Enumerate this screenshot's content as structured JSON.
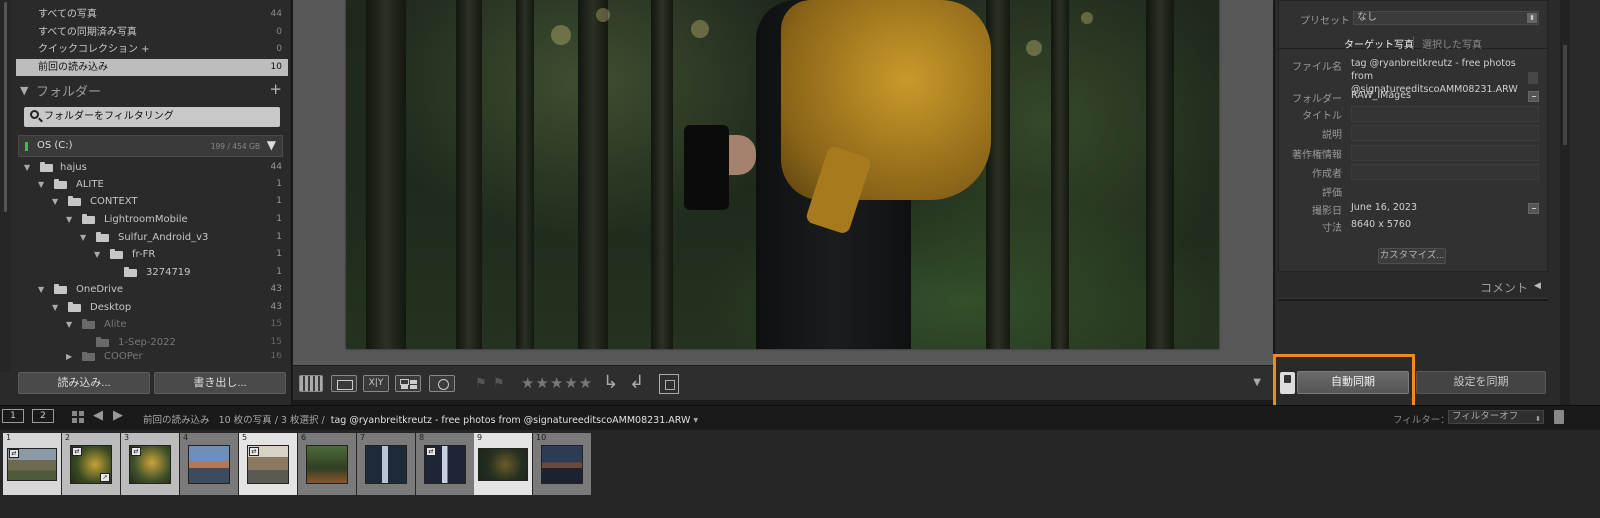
{
  "left_panel": {
    "catalog": [
      {
        "label": "すべての写真",
        "count": "44"
      },
      {
        "label": "すべての同期済み写真",
        "count": "0"
      },
      {
        "label": "クイックコレクション  +",
        "count": "0"
      },
      {
        "label": "前回の読み込み",
        "count": "10"
      }
    ],
    "folders_title": "フォルダー",
    "folders_add": "+",
    "folder_filter_placeholder": "フォルダーをフィルタリング",
    "volume": {
      "name": "OS (C:)",
      "usage": "199 / 454 GB"
    },
    "tree": [
      {
        "name": "hajus",
        "count": "44"
      },
      {
        "name": "ALITE",
        "count": "1"
      },
      {
        "name": "CONTEXT",
        "count": "1"
      },
      {
        "name": "LightroomMobile",
        "count": "1"
      },
      {
        "name": "Sulfur_Android_v3",
        "count": "1"
      },
      {
        "name": "fr-FR",
        "count": "1"
      },
      {
        "name": "3274719",
        "count": "1"
      },
      {
        "name": "OneDrive",
        "count": "43"
      },
      {
        "name": "Desktop",
        "count": "43"
      },
      {
        "name": "Alite",
        "count": "15"
      },
      {
        "name": "1-Sep-2022",
        "count": "15"
      },
      {
        "name": "COOPer",
        "count": "16"
      }
    ],
    "import_button": "読み込み...",
    "export_button": "書き出し..."
  },
  "toolbar": {
    "xy_label": "X|Y",
    "stars": "★★★★★"
  },
  "right_panel": {
    "preset_label": "プリセット",
    "preset_value": "なし",
    "tab_target": "ターゲット写真",
    "tab_selected": "選択した写真",
    "metadata": {
      "filename_label": "ファイル名",
      "filename_value": "tag @ryanbreitkreutz - free photos from @signatureeditscoAMM08231.ARW",
      "folder_label": "フォルダー",
      "folder_value": "RAW_IMages",
      "title_label": "タイトル",
      "caption_label": "説明",
      "copyright_label": "著作権情報",
      "creator_label": "作成者",
      "rating_label": "評価",
      "capture_label": "撮影日",
      "capture_value": "June 16, 2023",
      "dimensions_label": "寸法",
      "dimensions_value": "8640 x 5760"
    },
    "customize_button": "カスタマイズ...",
    "comments_title": "コメント",
    "auto_sync_button": "自動同期",
    "sync_settings_button": "設定を同期"
  },
  "filmstrip_bar": {
    "monitor1": "1",
    "monitor2": "2",
    "source": "前回の読み込み",
    "photo_count": "10 枚の写真 / 3 枚選択 /",
    "filename": "tag @ryanbreitkreutz - free photos from @signatureeditscoAMM08231.ARW",
    "filter_label": "フィルター：",
    "filter_value": "フィルターオフ"
  },
  "filmstrip": {
    "thumbs": [
      "1",
      "2",
      "3",
      "4",
      "5",
      "6",
      "7",
      "8",
      "9",
      "10"
    ]
  },
  "colors": {
    "highlight": "#f28a1d",
    "panel_bg": "#2a2a2a",
    "center_bg": "#585858"
  }
}
